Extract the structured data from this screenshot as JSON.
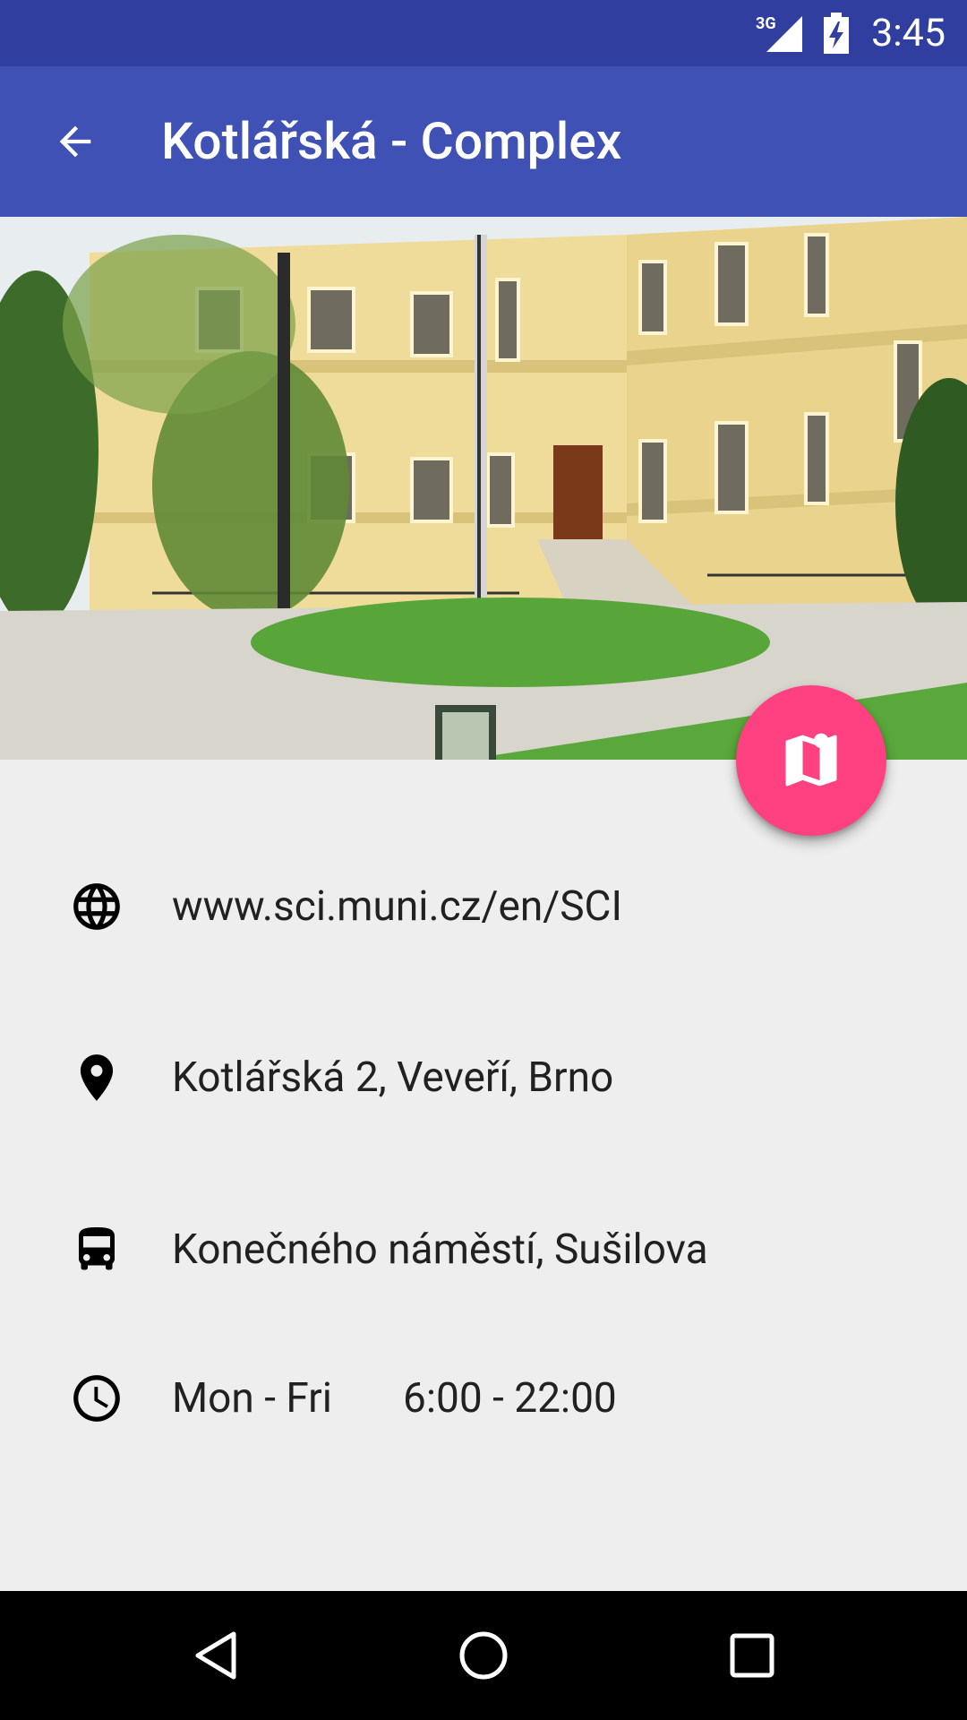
{
  "status_bar": {
    "network": "3G",
    "time": "3:45",
    "signal_icon": "cell-signal-icon",
    "battery_icon": "battery-charging-icon"
  },
  "app_bar": {
    "title": "Kotlářská - Complex",
    "back_icon": "arrow-back-icon"
  },
  "hero": {
    "image_description_icon": "building-photo"
  },
  "fab": {
    "icon": "map-icon",
    "color": "#ff4081"
  },
  "info": {
    "website": "www.sci.muni.cz/en/SCI",
    "address": "Kotlářská 2, Veveří, Brno",
    "transit": "Konečného náměstí, Sušilova",
    "hours_days": "Mon - Fri",
    "hours_time": "6:00 - 22:00"
  },
  "colors": {
    "primary": "#3f51b5",
    "primary_dark": "#303f9f",
    "accent": "#ff4081",
    "background": "#eeeeee"
  },
  "nav_bar": {
    "back_icon": "nav-back-icon",
    "home_icon": "nav-home-icon",
    "recents_icon": "nav-recents-icon"
  }
}
